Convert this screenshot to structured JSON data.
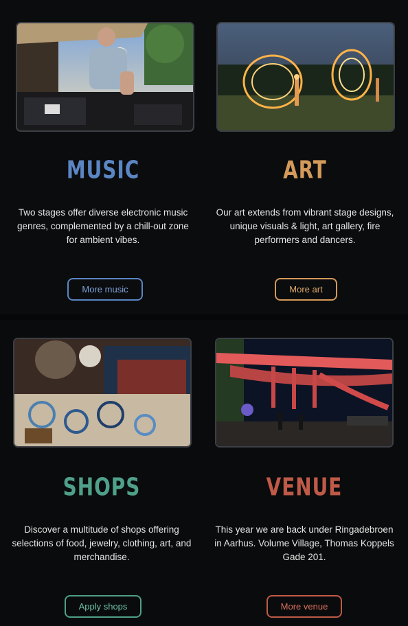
{
  "colors": {
    "music": "#5b86c4",
    "art": "#d49a5a",
    "shops": "#4fa08a",
    "venue": "#c05a48",
    "text": "#e6e6e6",
    "background": "#0a0b0d"
  },
  "cards": [
    {
      "id": "music",
      "title": "MUSIC",
      "description": "Two stages offer diverse electronic music genres, complemented by a chill-out zone for ambient vibes.",
      "button_label": "More music",
      "image_desc_icon": "dj-photo"
    },
    {
      "id": "art",
      "title": "ART",
      "description": "Our art extends from vibrant stage designs, unique visuals & light, art gallery, fire performers and dancers.",
      "button_label": "More art",
      "image_desc_icon": "fire-performers-photo"
    },
    {
      "id": "shops",
      "title": "SHOPS",
      "description": "Discover a multitude of shops offering selections of food, jewelry, clothing, art, and merchandise.",
      "button_label": "Apply shops",
      "image_desc_icon": "jewelry-stall-photo"
    },
    {
      "id": "venue",
      "title": "VENUE",
      "description": "This year we are back under Ringadebroen in Aarhus.   Volume Village, Thomas Koppels Gade 201.",
      "button_label": "More venue",
      "image_desc_icon": "bridge-venue-photo"
    }
  ]
}
